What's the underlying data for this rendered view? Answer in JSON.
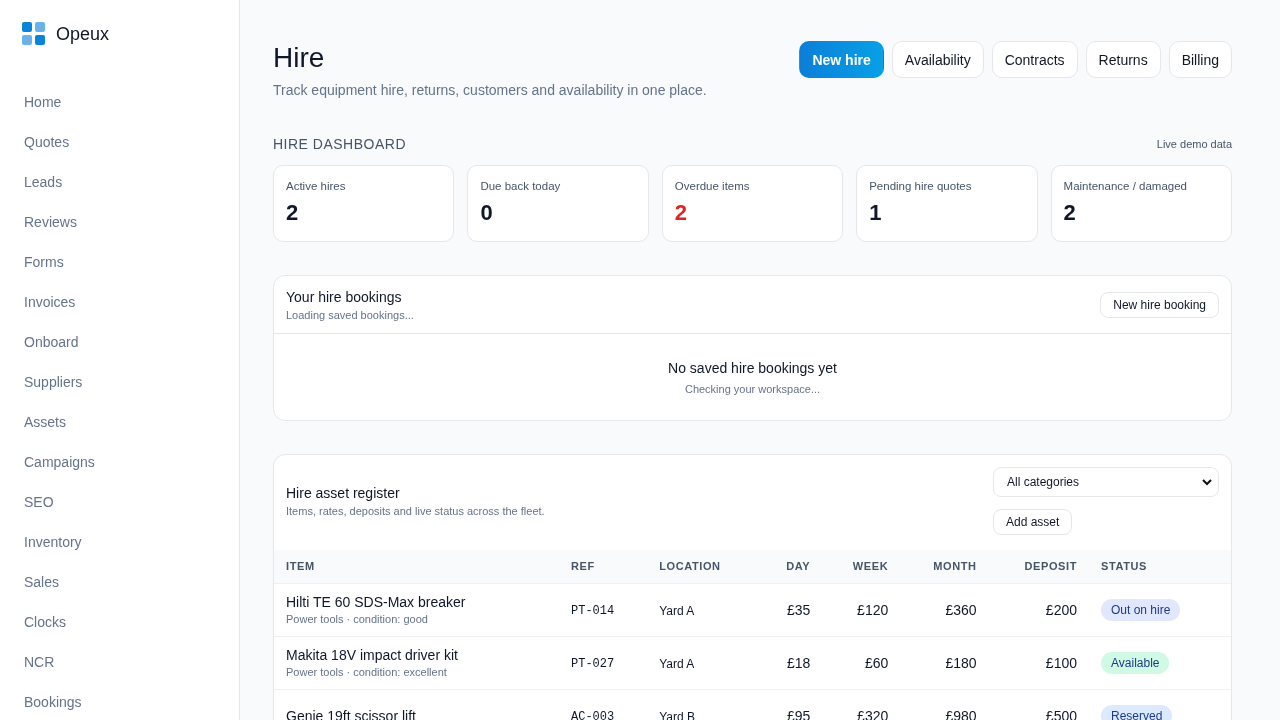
{
  "brand": "Opeux",
  "sidebar": {
    "items": [
      {
        "label": "Home"
      },
      {
        "label": "Quotes"
      },
      {
        "label": "Leads"
      },
      {
        "label": "Reviews"
      },
      {
        "label": "Forms"
      },
      {
        "label": "Invoices"
      },
      {
        "label": "Onboard"
      },
      {
        "label": "Suppliers"
      },
      {
        "label": "Assets"
      },
      {
        "label": "Campaigns"
      },
      {
        "label": "SEO"
      },
      {
        "label": "Inventory"
      },
      {
        "label": "Sales"
      },
      {
        "label": "Clocks"
      },
      {
        "label": "NCR"
      },
      {
        "label": "Bookings"
      }
    ]
  },
  "header": {
    "title": "Hire",
    "subtitle": "Track equipment hire, returns, customers and availability in one place.",
    "actions": [
      {
        "label": "New hire",
        "kind": "primary"
      },
      {
        "label": "Availability",
        "kind": "secondary"
      },
      {
        "label": "Contracts",
        "kind": "secondary"
      },
      {
        "label": "Returns",
        "kind": "secondary"
      },
      {
        "label": "Billing",
        "kind": "secondary"
      }
    ]
  },
  "dashboard": {
    "title": "HIRE DASHBOARD",
    "note": "Live demo data",
    "stats": [
      {
        "label": "Active hires",
        "value": "2",
        "alert": false
      },
      {
        "label": "Due back today",
        "value": "0",
        "alert": false
      },
      {
        "label": "Overdue items",
        "value": "2",
        "alert": true
      },
      {
        "label": "Pending hire quotes",
        "value": "1",
        "alert": false
      },
      {
        "label": "Maintenance / damaged",
        "value": "2",
        "alert": false
      }
    ]
  },
  "bookings": {
    "title": "Your hire bookings",
    "subtitle": "Loading saved bookings...",
    "button": "New hire booking",
    "empty_title": "No saved hire bookings yet",
    "empty_subtitle": "Checking your workspace..."
  },
  "register": {
    "title": "Hire asset register",
    "subtitle": "Items, rates, deposits and live status across the fleet.",
    "filter": "All categories",
    "button": "Add asset",
    "columns": [
      "ITEM",
      "REF",
      "LOCATION",
      "DAY",
      "WEEK",
      "MONTH",
      "DEPOSIT",
      "STATUS"
    ],
    "rows": [
      {
        "item": "Hilti TE 60 SDS-Max breaker",
        "detail": "Power tools · condition: good",
        "ref": "PT-014",
        "location": "Yard A",
        "day": "£35",
        "week": "£120",
        "month": "£360",
        "deposit": "£200",
        "status": "Out on hire",
        "color": "#e0e7ff"
      },
      {
        "item": "Makita 18V impact driver kit",
        "detail": "Power tools · condition: excellent",
        "ref": "PT-027",
        "location": "Yard A",
        "day": "£18",
        "week": "£60",
        "month": "£180",
        "deposit": "£100",
        "status": "Available",
        "color": "#d1fae5"
      },
      {
        "item": "Genie 19ft scissor lift",
        "ref": "AC-003",
        "location": "Yard B",
        "day": "£95",
        "week": "£320",
        "month": "£980",
        "deposit": "£500",
        "status": "Reserved",
        "color": "#dbeafe"
      }
    ]
  }
}
